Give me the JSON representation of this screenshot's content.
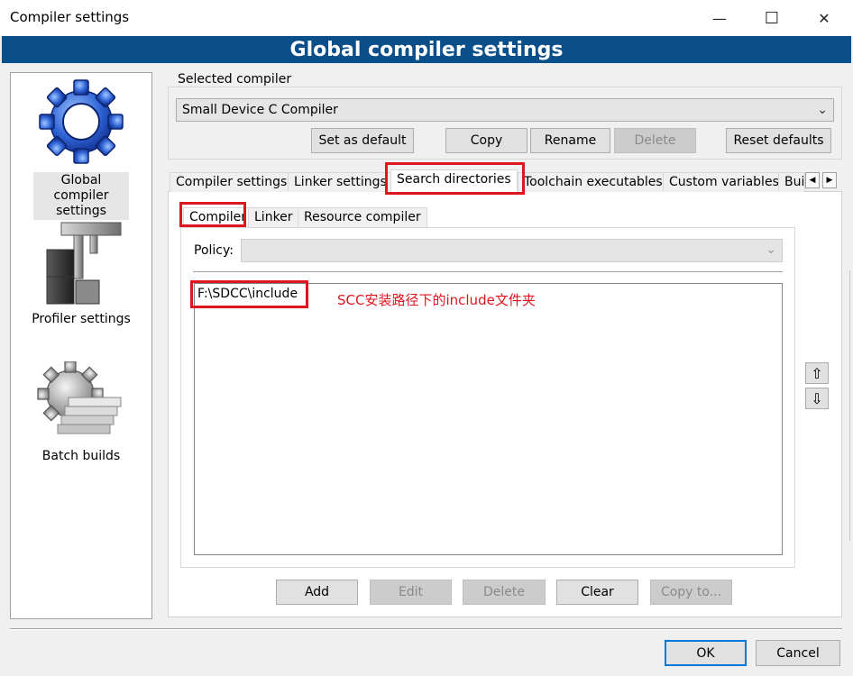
{
  "window": {
    "title": "Compiler settings",
    "minimize_icon": "—",
    "maximize_icon": "☐",
    "close_icon": "✕"
  },
  "banner": {
    "title": "Global compiler settings"
  },
  "categories": [
    {
      "label": "Global compiler settings",
      "icon": "gear-icon",
      "selected": true
    },
    {
      "label": "Profiler settings",
      "icon": "caliper-icon",
      "selected": false
    },
    {
      "label": "Batch builds",
      "icon": "gear-stack-icon",
      "selected": false
    }
  ],
  "selected_compiler": {
    "legend": "Selected compiler",
    "value": "Small Device C Compiler",
    "buttons": {
      "set_default": "Set as default",
      "copy": "Copy",
      "rename": "Rename",
      "delete": "Delete",
      "reset_defaults": "Reset defaults"
    }
  },
  "tabs": [
    "Compiler settings",
    "Linker settings",
    "Search directories",
    "Toolchain executables",
    "Custom variables",
    "Bui"
  ],
  "active_tab": "Search directories",
  "subtabs": [
    "Compiler",
    "Linker",
    "Resource compiler"
  ],
  "active_subtab": "Compiler",
  "policy": {
    "label": "Policy:",
    "value": ""
  },
  "directories": [
    "F:\\SDCC\\include"
  ],
  "annotation": "SCC安装路径下的include文件夹",
  "list_buttons": {
    "add": "Add",
    "edit": "Edit",
    "delete": "Delete",
    "clear": "Clear",
    "copy_to": "Copy to..."
  },
  "dialog_buttons": {
    "ok": "OK",
    "cancel": "Cancel"
  },
  "colors": {
    "banner": "#0b4f8a",
    "annotation_red": "#e0161f",
    "focus_blue": "#0078d7"
  }
}
